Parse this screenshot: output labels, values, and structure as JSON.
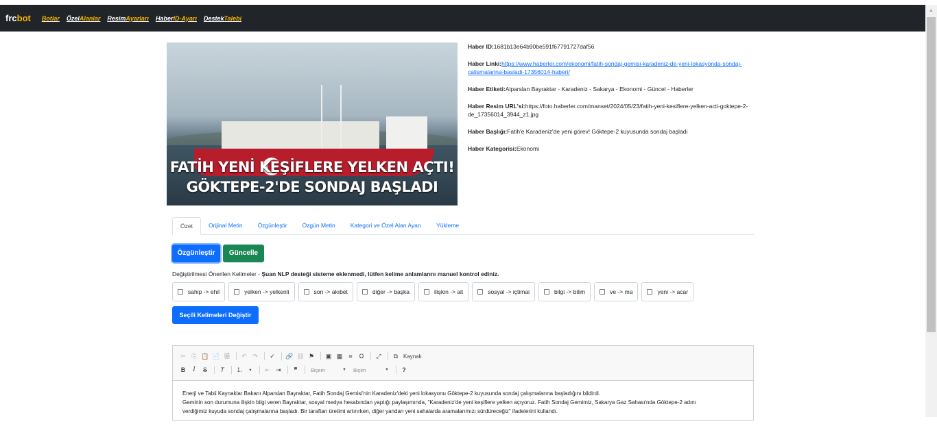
{
  "navbar": {
    "brand": {
      "a": "frc",
      "b": "bot"
    },
    "links": [
      {
        "a": "",
        "b": "Botlar"
      },
      {
        "a": "Özel",
        "b": "Alanlar"
      },
      {
        "a": "Resim",
        "b": "Ayarları"
      },
      {
        "a": "Haber",
        "b": "ID-Ayarı"
      },
      {
        "a": "Destek",
        "b": "Talebi"
      }
    ]
  },
  "hero": {
    "caption_line1": "FATİH YENİ KEŞİFLERE YELKEN AÇTI!",
    "caption_line2": "GÖKTEPE-2'DE SONDAJ BAŞLADI"
  },
  "info": {
    "id": {
      "label": "Haber ID:",
      "value": "1681b13e64b90be591f67791727daf56"
    },
    "link": {
      "label": "Haber Linki:",
      "value": "https://www.haberler.com/ekonomi/fatih-sondaj-gemisi-karadeniz-de-yeni-lokasyonda-sondaj-calismalarina-basladi-17356014-haberi/"
    },
    "tags": {
      "label": "Haber Etiketi:",
      "value": "Alparslan Bayraktar - Karadeniz - Sakarya - Ekonomi - Güncel - Haberler"
    },
    "image": {
      "label": "Haber Resim URL'si:",
      "value": "https://foto.haberler.com/manset/2024/05/23/fatih-yeni-kesiflere-yelken-acti-goktepe-2-de_17356014_3944_z1.jpg"
    },
    "title": {
      "label": "Haber Başlığı:",
      "value": "Fatih'e Karadeniz'de yeni görev! Göktepe-2 kuyusunda sondaj başladı"
    },
    "category": {
      "label": "Haber Kategorisi:",
      "value": "Ekonomi"
    }
  },
  "tabs": [
    "Özet",
    "Orijinal Metin",
    "Özgünleştir",
    "Özgün Metin",
    "Kategori ve Özel Alan Ayarı",
    "Yükleme"
  ],
  "buttons": {
    "ozgunlestir": "Özgünleştir",
    "guncelle": "Güncelle",
    "change_selected": "Seçili Kelimeleri Değiştir"
  },
  "note": {
    "text": "Değiştirilmesi Önerilen Kelimeler - ",
    "bold": "Şuan NLP desteği sisteme eklenmedi, lütfen kelime anlamlarını manuel kontrol ediniz."
  },
  "words": [
    "sahip -> ehil",
    "yelken -> yelkenli",
    "son -> akıbet",
    "diğer -> başka",
    "ilişkin -> ait",
    "sosyal -> içtimai",
    "bilgi -> bilim",
    "ve -> ma",
    "yeni -> acar"
  ],
  "editor": {
    "source_label": "Kaynak",
    "combo1": "Biçem",
    "combo2": "Biçim",
    "lines": [
      "Enerji ve Tabii Kaynaklar Bakanı Alparslan Bayraktar, Fatih Sondaj Gemisi'nin Karadeniz'deki yeni lokasyonu Göktepe-2 kuyusunda sondaj çalışmalarına başladığını bildirdi.",
      "Geminin son durumuna ilişkin bilgi veren Bayraktar, sosyal medya hesabından yaptığı paylaşımında, \"Karadeniz'de yeni keşiflere yelken açıyoruz. Fatih Sondaj Gemimiz, Sakarya Gaz Sahası'nda Göktepe-2 adını",
      "verdiğimiz kuyuda sondaj çalışmalarına başladı. Bir taraftan üretimi artırırken, diğer yandan yeni sahalarda aramalarımızı sürdüreceğiz\" ifadelerini kullandı."
    ]
  },
  "colors": {
    "navbar": "#212529",
    "accent": "#f5b301",
    "primary": "#0d6efd",
    "success": "#198754"
  }
}
